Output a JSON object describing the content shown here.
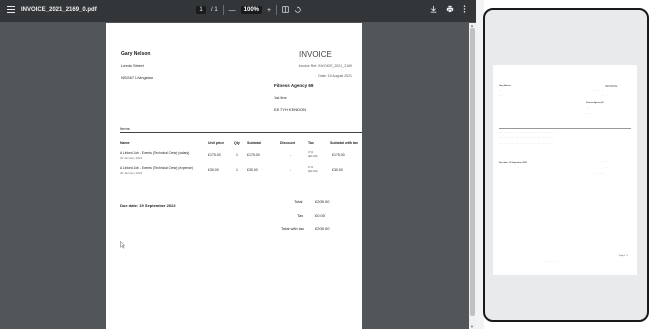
{
  "toolbar": {
    "title": "INVOICE_2021_2169_0.pdf",
    "page_current": "1",
    "page_total": "/ 1",
    "zoom_minus": "—",
    "zoom": "100%",
    "zoom_plus": "+",
    "fit_icon": "fit-page-icon",
    "rotate_icon": "rotate-icon",
    "download_icon": "download-icon",
    "print_icon": "print-icon",
    "more_icon": "more-vert-icon"
  },
  "invoice": {
    "from_name": "Gary Nelson",
    "from_street": "Leeds Street",
    "from_city": "NSG67 Livingston",
    "heading": "INVOICE",
    "ref": "Invoice Ref: INVOICE_2021_2169",
    "date": "Date: 19 August 2021",
    "to_name": "Fitness Agency 69",
    "to_line": "1st line",
    "to_city": "E8 7YH KENDON",
    "items_title": "Items",
    "columns": [
      "Name",
      "Unit price",
      "Qty",
      "Subtotal",
      "Discount",
      "Tax",
      "Subtotal with tax"
    ],
    "rows": [
      {
        "name": "A Linked Job - Events (Technical Crew) (salary)",
        "sub": "30 January 2022",
        "unit_price": "£175.00",
        "qty": "1",
        "subtotal": "£175.00",
        "discount": "-",
        "tax": "0 %\n(£0.00)",
        "total": "£175.00"
      },
      {
        "name": "A Linked Job - Events (Technical Crew) (expense)",
        "sub": "30 January 2022",
        "unit_price": "£30.00",
        "qty": "1",
        "subtotal": "£30.00",
        "discount": "-",
        "tax": "0 %\n(£0.00)",
        "total": "£30.00"
      }
    ],
    "due_date": "Due date: 19 September 2022",
    "totals": [
      {
        "label": "Total",
        "value": "£205.00"
      },
      {
        "label": "Tax",
        "value": "£0.00"
      },
      {
        "label": "Total with tax",
        "value": "£205.00"
      }
    ]
  },
  "preview": {
    "from_name": "Gary Nelson",
    "heading": "INVOICE",
    "to_name": "Fitness Agency 69",
    "due_date": "Due date: 19 September 2022",
    "footer": "Page 1 / 1"
  },
  "colors": {
    "viewer_bg": "#525659",
    "toolbar_bg": "#323639"
  }
}
